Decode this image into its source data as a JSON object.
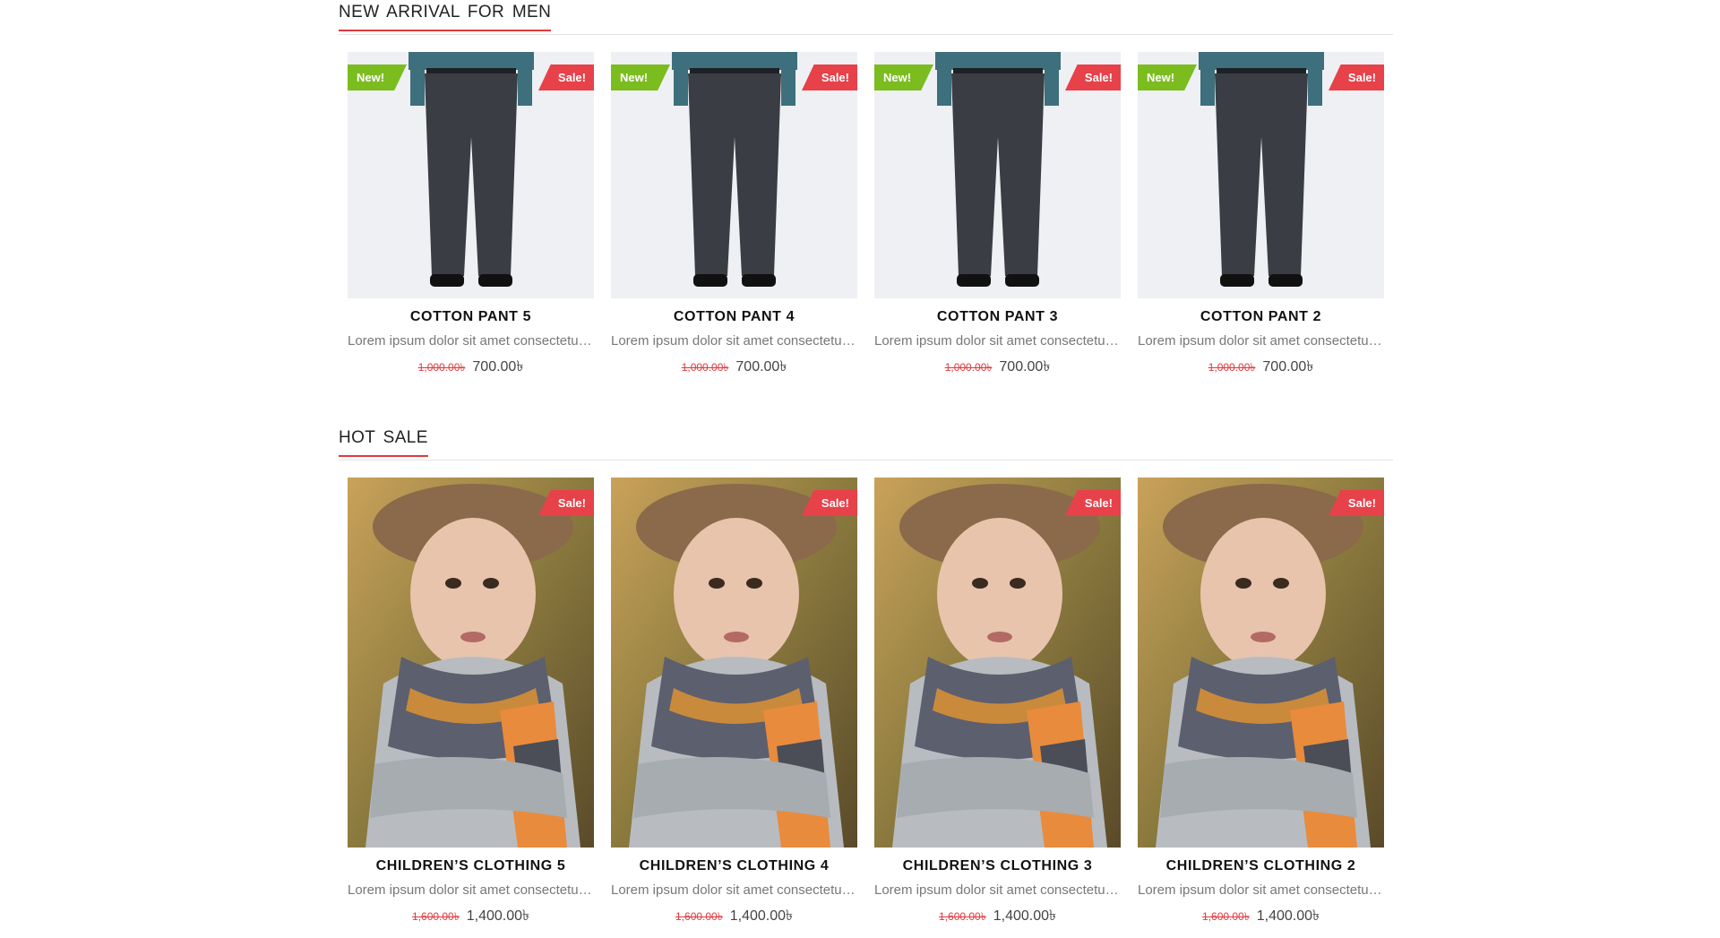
{
  "sections": [
    {
      "title": "NEW ARRIVAL FOR MEN",
      "products": [
        {
          "name": "COTTON PANT 5",
          "desc": "Lorem ipsum dolor sit amet consectetur adipiscing",
          "old_price": "1,000.00৳",
          "price": "700.00৳",
          "new_badge": "New!",
          "sale_badge": "Sale!",
          "image": "men-trousers"
        },
        {
          "name": "COTTON PANT 4",
          "desc": "Lorem ipsum dolor sit amet consectetur adipiscing",
          "old_price": "1,000.00৳",
          "price": "700.00৳",
          "new_badge": "New!",
          "sale_badge": "Sale!",
          "image": "men-trousers"
        },
        {
          "name": "COTTON PANT 3",
          "desc": "Lorem ipsum dolor sit amet consectetur adipiscing",
          "old_price": "1,000.00৳",
          "price": "700.00৳",
          "new_badge": "New!",
          "sale_badge": "Sale!",
          "image": "men-trousers"
        },
        {
          "name": "COTTON PANT 2",
          "desc": "Lorem ipsum dolor sit amet consectetur adipiscing",
          "old_price": "1,000.00৳",
          "price": "700.00৳",
          "new_badge": "New!",
          "sale_badge": "Sale!",
          "image": "men-trousers"
        }
      ]
    },
    {
      "title": "HOT SALE",
      "products": [
        {
          "name": "CHILDREN’S CLOTHING 5",
          "desc": "Lorem ipsum dolor sit amet consectetur adipiscing",
          "old_price": "1,600.00৳",
          "price": "1,400.00৳",
          "sale_badge": "Sale!",
          "image": "child-scarf"
        },
        {
          "name": "CHILDREN’S CLOTHING 4",
          "desc": "Lorem ipsum dolor sit amet consectetur adipiscing",
          "old_price": "1,600.00৳",
          "price": "1,400.00৳",
          "sale_badge": "Sale!",
          "image": "child-scarf"
        },
        {
          "name": "CHILDREN’S CLOTHING 3",
          "desc": "Lorem ipsum dolor sit amet consectetur adipiscing",
          "old_price": "1,600.00৳",
          "price": "1,400.00৳",
          "sale_badge": "Sale!",
          "image": "child-scarf"
        },
        {
          "name": "CHILDREN’S CLOTHING 2",
          "desc": "Lorem ipsum dolor sit amet consectetur adipiscing",
          "old_price": "1,600.00৳",
          "price": "1,400.00৳",
          "sale_badge": "Sale!",
          "image": "child-scarf"
        }
      ]
    }
  ],
  "colors": {
    "accent": "#e0393e",
    "new_badge": "#7bbc1f",
    "sale_badge": "#e74149"
  }
}
